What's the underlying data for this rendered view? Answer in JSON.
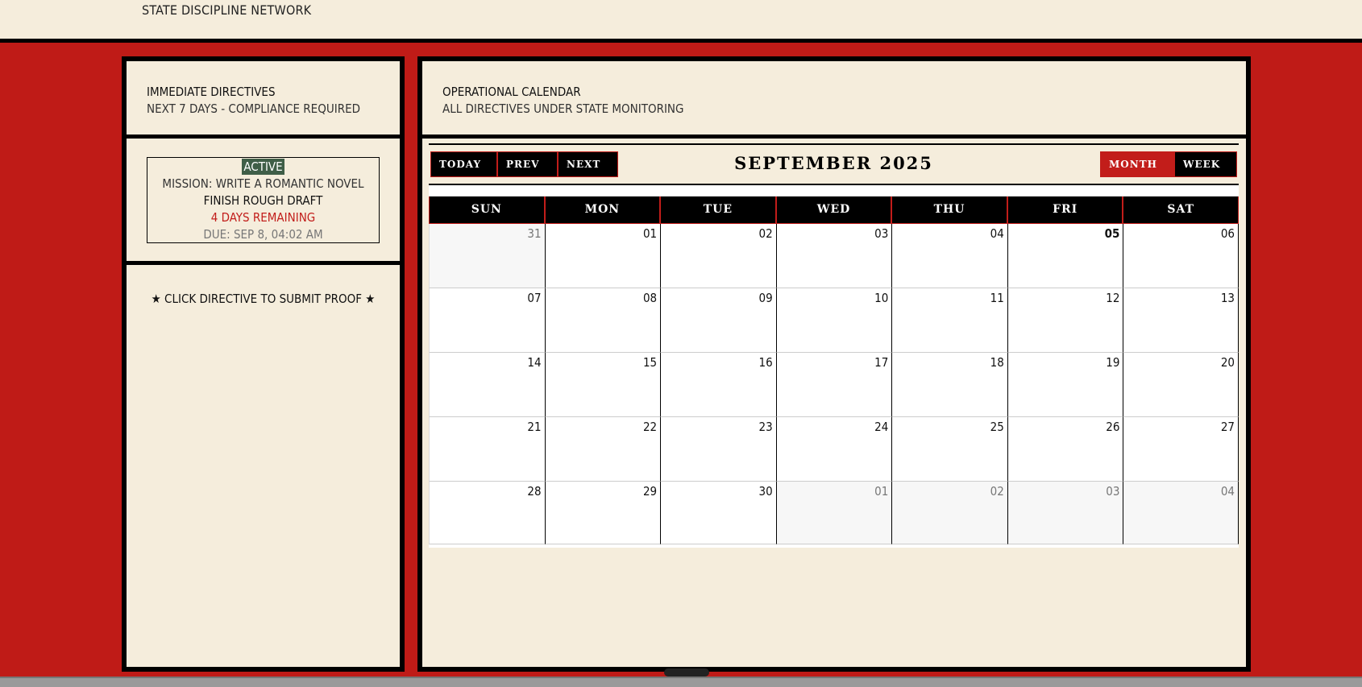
{
  "header": {
    "brand": "STATE DISCIPLINE NETWORK"
  },
  "sidebar": {
    "title": "IMMEDIATE DIRECTIVES",
    "subtitle": "NEXT 7 DAYS - COMPLIANCE REQUIRED",
    "directive": {
      "status": "ACTIVE",
      "mission": "MISSION: WRITE A ROMANTIC NOVEL",
      "task": "FINISH ROUGH DRAFT",
      "remaining": "4 DAYS REMAINING",
      "due": "DUE: SEP 8, 04:02 AM"
    },
    "hint": "★ CLICK DIRECTIVE TO SUBMIT PROOF ★"
  },
  "main": {
    "title": "OPERATIONAL CALENDAR",
    "subtitle": "ALL DIRECTIVES UNDER STATE MONITORING"
  },
  "calendar": {
    "month_label": "SEPTEMBER 2025",
    "buttons": {
      "today": "TODAY",
      "prev": "PREV",
      "next": "NEXT",
      "month": "MONTH",
      "week": "WEEK"
    },
    "active_view": "month",
    "weekdays": [
      "SUN",
      "MON",
      "TUE",
      "WED",
      "THU",
      "FRI",
      "SAT"
    ],
    "weeks": [
      [
        {
          "d": "31",
          "other": true
        },
        {
          "d": "01"
        },
        {
          "d": "02"
        },
        {
          "d": "03"
        },
        {
          "d": "04"
        },
        {
          "d": "05",
          "today": true
        },
        {
          "d": "06"
        }
      ],
      [
        {
          "d": "07"
        },
        {
          "d": "08"
        },
        {
          "d": "09"
        },
        {
          "d": "10"
        },
        {
          "d": "11"
        },
        {
          "d": "12"
        },
        {
          "d": "13"
        }
      ],
      [
        {
          "d": "14"
        },
        {
          "d": "15"
        },
        {
          "d": "16"
        },
        {
          "d": "17"
        },
        {
          "d": "18"
        },
        {
          "d": "19"
        },
        {
          "d": "20"
        }
      ],
      [
        {
          "d": "21"
        },
        {
          "d": "22"
        },
        {
          "d": "23"
        },
        {
          "d": "24"
        },
        {
          "d": "25"
        },
        {
          "d": "26"
        },
        {
          "d": "27"
        }
      ],
      [
        {
          "d": "28"
        },
        {
          "d": "29"
        },
        {
          "d": "30"
        },
        {
          "d": "01",
          "other": true
        },
        {
          "d": "02",
          "other": true
        },
        {
          "d": "03",
          "other": true
        },
        {
          "d": "04",
          "other": true
        }
      ]
    ]
  },
  "colors": {
    "accent": "#c21d1a",
    "panel": "#f5eddc",
    "status_badge": "#3f5e47"
  }
}
